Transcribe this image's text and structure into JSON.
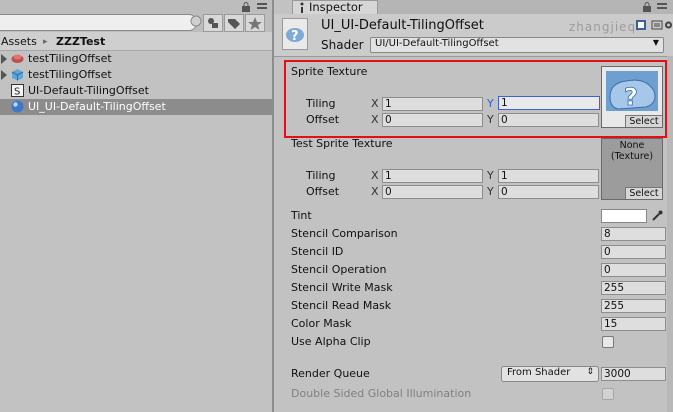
{
  "project": {
    "search_value": "",
    "breadcrumb": [
      "Assets",
      "ZZZTest"
    ],
    "items": [
      {
        "label": "testTilingOffset",
        "icon": "unity-scene-icon",
        "expandable": true
      },
      {
        "label": "testTilingOffset",
        "icon": "prefab-cube-icon",
        "expandable": true
      },
      {
        "label": "UI-Default-TilingOffset",
        "icon": "shader-icon",
        "expandable": false
      },
      {
        "label": "UI_UI-Default-TilingOffset",
        "icon": "material-sphere-icon",
        "expandable": false,
        "selected": true
      }
    ]
  },
  "inspector": {
    "tab_label": "Inspector",
    "title": "UI_UI-Default-TilingOffset",
    "shader_label": "Shader",
    "shader_value": "UI/UI-Default-TilingOffset",
    "watermark": "zhangjieqi",
    "sprite_texture": {
      "label": "Sprite Texture",
      "tiling_label": "Tiling",
      "offset_label": "Offset",
      "x_label": "X",
      "y_label": "Y",
      "tiling_x": "1",
      "tiling_y": "1",
      "offset_x": "0",
      "offset_y": "0",
      "select_label": "Select"
    },
    "test_sprite_texture": {
      "label": "Test Sprite Texture",
      "tiling_label": "Tiling",
      "offset_label": "Offset",
      "x_label": "X",
      "y_label": "Y",
      "tiling_x": "1",
      "tiling_y": "1",
      "offset_x": "0",
      "offset_y": "0",
      "none_label": "None\n(Texture)",
      "select_label": "Select"
    },
    "tint_label": "Tint",
    "tint_color": "#ffffff",
    "properties": [
      {
        "label": "Stencil Comparison",
        "value": "8"
      },
      {
        "label": "Stencil ID",
        "value": "0"
      },
      {
        "label": "Stencil Operation",
        "value": "0"
      },
      {
        "label": "Stencil Write Mask",
        "value": "255"
      },
      {
        "label": "Stencil Read Mask",
        "value": "255"
      },
      {
        "label": "Color Mask",
        "value": "15"
      }
    ],
    "use_alpha_clip_label": "Use Alpha Clip",
    "use_alpha_clip": false,
    "render_queue_label": "Render Queue",
    "render_queue_mode": "From Shader",
    "render_queue_value": "3000",
    "dsgi_label": "Double Sided Global Illumination",
    "dsgi": false
  },
  "colors": {
    "highlight_border": "#e20f17",
    "focus_blue": "#3c62d8",
    "selection_row": "#8c8c8c"
  }
}
